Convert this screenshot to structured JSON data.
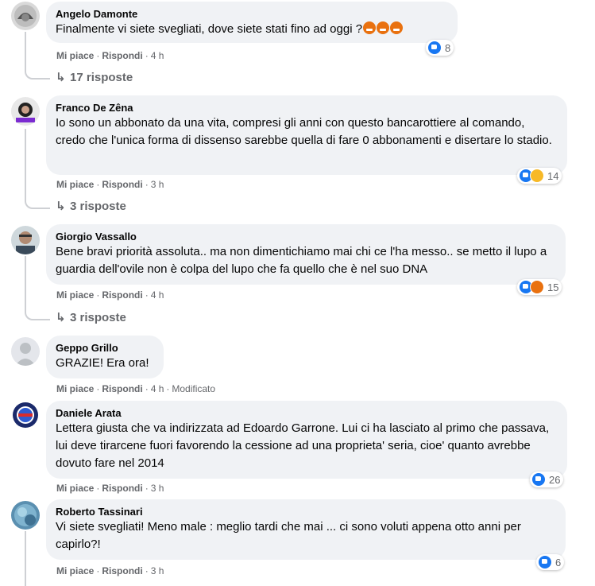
{
  "comments": [
    {
      "author": "Angelo Damonte",
      "text": "Finalmente vi siete svegliati, dove siete stati fino ad oggi ?",
      "emoji_icons": [
        "angry-face-icon",
        "angry-face-icon",
        "angry-face-icon"
      ],
      "like_label": "Mi piace",
      "reply_label": "Rispondi",
      "time": "4 h",
      "reactions": [
        "like-icon"
      ],
      "reaction_count": "8",
      "replies": "17 risposte"
    },
    {
      "author": "Franco De Zêna",
      "text": "Io sono un abbonato da una vita, compresi gli anni con questo bancarottiere al comando, credo che l'unica forma di dissenso sarebbe quella di fare 0 abbonamenti e disertare lo stadio.",
      "like_label": "Mi piace",
      "reply_label": "Rispondi",
      "time": "3 h",
      "reactions": [
        "like-icon",
        "haha-icon"
      ],
      "reaction_count": "14",
      "replies": "3 risposte"
    },
    {
      "author": "Giorgio Vassallo",
      "text": "Bene bravi priorità assoluta.. ma non dimentichiamo mai chi ce l'ha messo.. se metto il lupo a guardia dell'ovile non è colpa del lupo che fa quello che è nel suo DNA",
      "like_label": "Mi piace",
      "reply_label": "Rispondi",
      "time": "4 h",
      "reactions": [
        "like-icon",
        "angry-icon"
      ],
      "reaction_count": "15",
      "replies": "3 risposte"
    },
    {
      "author": "Geppo Grillo",
      "text": "GRAZIE! Era ora!",
      "like_label": "Mi piace",
      "reply_label": "Rispondi",
      "time": "4 h",
      "edited": "Modificato"
    },
    {
      "author": "Daniele Arata",
      "text": "Lettera giusta che va indirizzata ad Edoardo Garrone. Lui ci ha lasciato al primo che passava, lui deve tirarcene fuori favorendo la cessione ad una proprieta' seria, cioe' quanto avrebbe dovuto fare nel 2014",
      "like_label": "Mi piace",
      "reply_label": "Rispondi",
      "time": "3 h",
      "reactions": [
        "like-icon"
      ],
      "reaction_count": "26"
    },
    {
      "author": "Roberto Tassinari",
      "text": "Vi siete svegliati! Meno male : meglio tardi che mai ... ci sono voluti appena otto anni per capirlo?!",
      "like_label": "Mi piace",
      "reply_label": "Rispondi",
      "time": "3 h",
      "reactions": [
        "like-icon"
      ],
      "reaction_count": "6"
    }
  ],
  "colors": {
    "bubble": "#f0f2f5",
    "secondary_text": "#65676b",
    "like_blue": "#1877f2",
    "haha_yellow": "#f7b928",
    "angry_orange": "#e9710f"
  }
}
